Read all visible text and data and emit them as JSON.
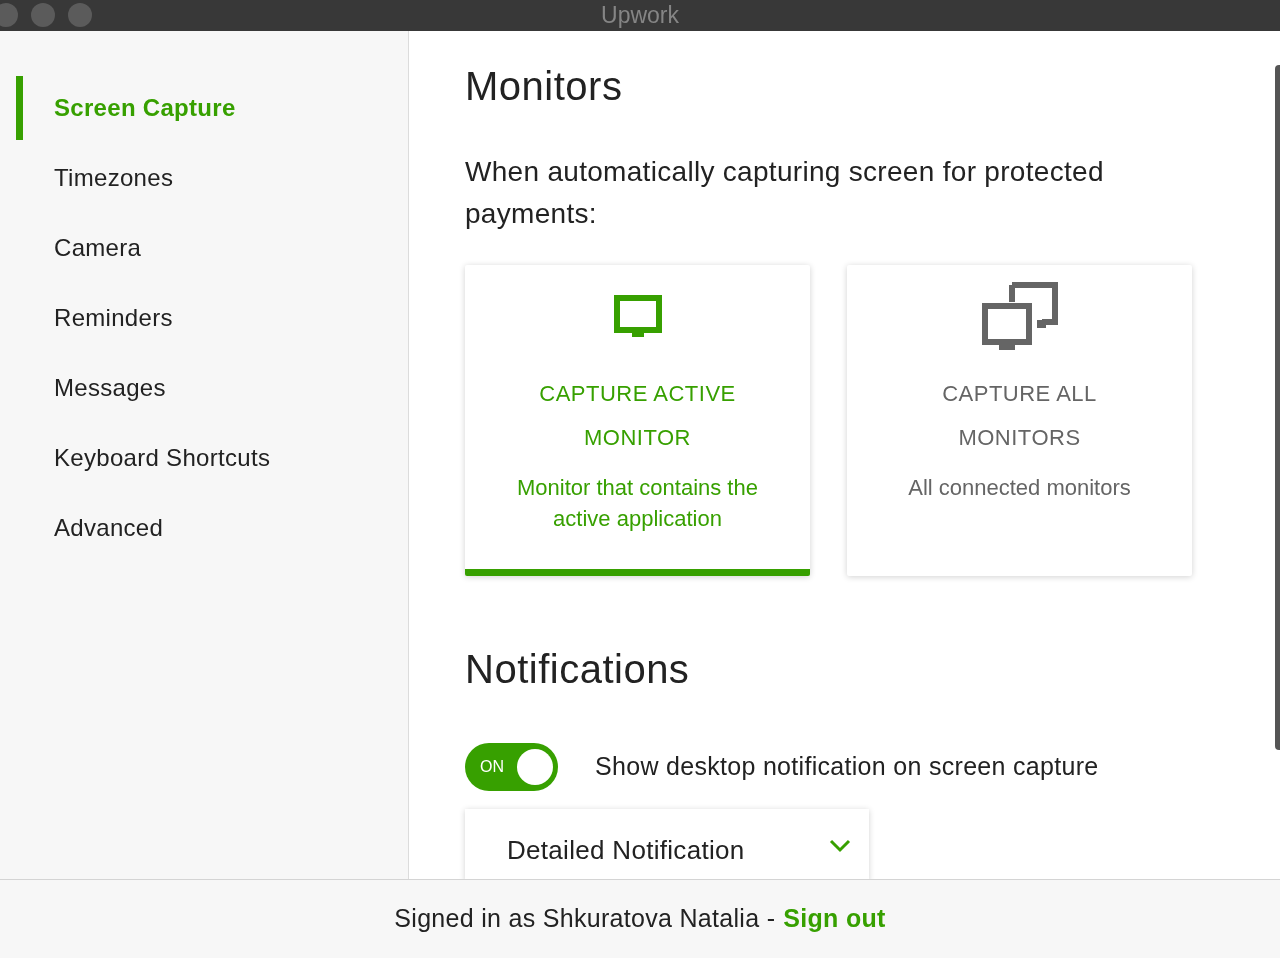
{
  "window": {
    "title": "Upwork"
  },
  "sidebar": {
    "items": [
      {
        "label": "Screen Capture",
        "selected": true
      },
      {
        "label": "Timezones",
        "selected": false
      },
      {
        "label": "Camera",
        "selected": false
      },
      {
        "label": "Reminders",
        "selected": false
      },
      {
        "label": "Messages",
        "selected": false
      },
      {
        "label": "Keyboard Shortcuts",
        "selected": false
      },
      {
        "label": "Advanced",
        "selected": false
      }
    ]
  },
  "monitors": {
    "heading": "Monitors",
    "question": "When automatically capturing screen for protected payments:",
    "options": [
      {
        "kind": "single",
        "title": "CAPTURE ACTIVE MONITOR",
        "description": "Monitor that contains the active application",
        "selected": true
      },
      {
        "kind": "multiple",
        "title": "CAPTURE ALL MONITORS",
        "description": "All connected monitors",
        "selected": false
      }
    ]
  },
  "notifications": {
    "heading": "Notifications",
    "toggle": {
      "label": "ON",
      "on": true
    },
    "toggle_text": "Show desktop notification on screen capture",
    "dropdown": {
      "value": "Detailed Notification"
    }
  },
  "footer": {
    "text": "Signed in as Shkuratova Natalia -",
    "link": "Sign out"
  }
}
